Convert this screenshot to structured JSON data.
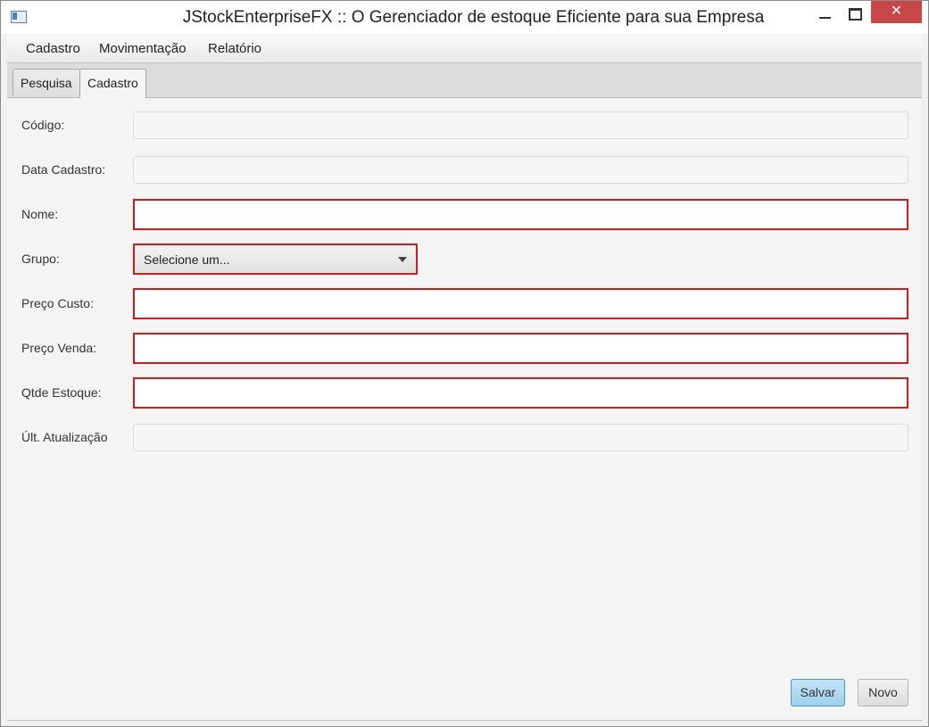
{
  "window": {
    "title": "JStockEnterpriseFX :: O Gerenciador de estoque Eficiente para sua Empresa",
    "close_glyph": "✕"
  },
  "menu": {
    "items": [
      "Cadastro",
      "Movimentação",
      "Relatório"
    ]
  },
  "tabs": {
    "items": [
      "Pesquisa",
      "Cadastro"
    ],
    "selected": "Cadastro"
  },
  "form": {
    "codigo": {
      "label": "Código:",
      "value": ""
    },
    "data_cadastro": {
      "label": "Data Cadastro:",
      "value": ""
    },
    "nome": {
      "label": "Nome:",
      "value": ""
    },
    "grupo": {
      "label": "Grupo:",
      "selected": "Selecione um..."
    },
    "preco_custo": {
      "label": "Preço Custo:",
      "value": ""
    },
    "preco_venda": {
      "label": "Preço Venda:",
      "value": ""
    },
    "qtde_estoque": {
      "label": "Qtde Estoque:",
      "value": ""
    },
    "ult_atualizacao": {
      "label": "Últ. Atualização",
      "value": ""
    }
  },
  "buttons": {
    "salvar": "Salvar",
    "novo": "Novo"
  },
  "colors": {
    "required_border": "#d21b1b",
    "primary_button": "#9fd0ec",
    "close_button": "#c84747"
  }
}
